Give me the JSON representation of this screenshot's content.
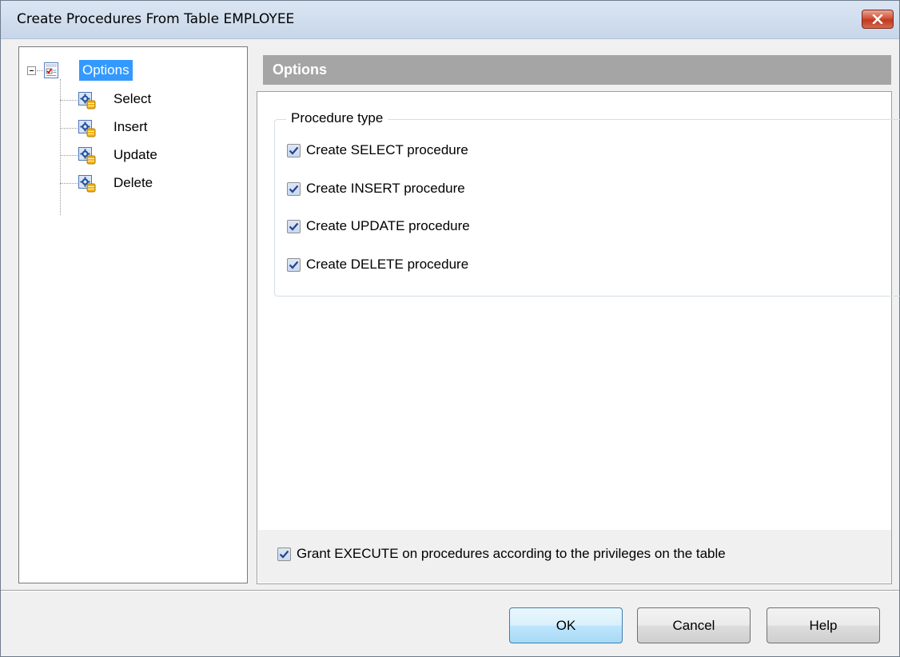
{
  "window": {
    "title": "Create Procedures From Table EMPLOYEE"
  },
  "tree": {
    "root": {
      "label": "Options",
      "icon": "options-check-icon",
      "selected": true,
      "expanded": true
    },
    "children": [
      {
        "label": "Select",
        "icon": "procedure-icon"
      },
      {
        "label": "Insert",
        "icon": "procedure-icon"
      },
      {
        "label": "Update",
        "icon": "procedure-icon"
      },
      {
        "label": "Delete",
        "icon": "procedure-icon"
      }
    ]
  },
  "panel": {
    "header": "Options",
    "group_title": "Procedure type",
    "checks": [
      {
        "label": "Create SELECT procedure",
        "checked": true
      },
      {
        "label": "Create INSERT procedure",
        "checked": true
      },
      {
        "label": "Create UPDATE procedure",
        "checked": true
      },
      {
        "label": "Create DELETE procedure",
        "checked": true
      }
    ],
    "grant": {
      "label": "Grant EXECUTE on procedures according to the privileges on the table",
      "checked": true
    }
  },
  "buttons": {
    "ok": "OK",
    "cancel": "Cancel",
    "help": "Help"
  },
  "colors": {
    "selection": "#3399ff",
    "header_bg": "#a5a5a5",
    "close_button": "#c0391f"
  }
}
